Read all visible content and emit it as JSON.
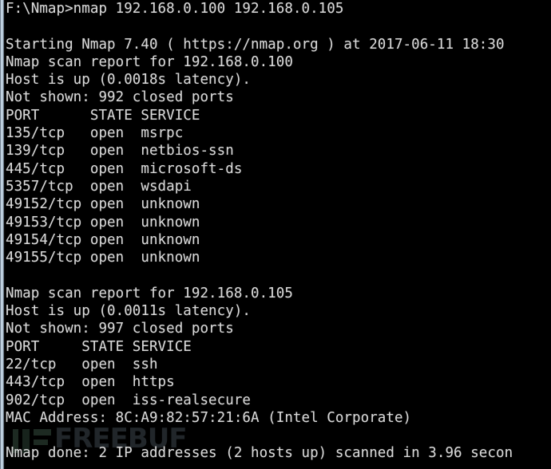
{
  "window": {
    "type": "windows-command-prompt",
    "background_color": "#000000",
    "text_color": "#d8d8d8",
    "border_color": "#b4c6d6"
  },
  "watermark": {
    "text": "FREEBUF",
    "color": "#21262a",
    "accent_color": "#1d2a22"
  },
  "terminal": {
    "prompt": "F:\\Nmap>",
    "command": "nmap 192.168.0.100 192.168.0.105",
    "lines": [
      "F:\\Nmap>nmap 192.168.0.100 192.168.0.105",
      "",
      "Starting Nmap 7.40 ( https://nmap.org ) at 2017-06-11 18:30 ",
      "Nmap scan report for 192.168.0.100",
      "Host is up (0.0018s latency).",
      "Not shown: 992 closed ports",
      "PORT      STATE SERVICE",
      "135/tcp   open  msrpc",
      "139/tcp   open  netbios-ssn",
      "445/tcp   open  microsoft-ds",
      "5357/tcp  open  wsdapi",
      "49152/tcp open  unknown",
      "49153/tcp open  unknown",
      "49154/tcp open  unknown",
      "49155/tcp open  unknown",
      "",
      "Nmap scan report for 192.168.0.105",
      "Host is up (0.0011s latency).",
      "Not shown: 997 closed ports",
      "PORT     STATE SERVICE",
      "22/tcp   open  ssh",
      "443/tcp  open  https",
      "902/tcp  open  iss-realsecure",
      "MAC Address: 8C:A9:82:57:21:6A (Intel Corporate)",
      "",
      "Nmap done: 2 IP addresses (2 hosts up) scanned in 3.96 secon"
    ]
  },
  "scan_summary": {
    "nmap_version": "7.40",
    "nmap_url": "https://nmap.org",
    "scan_datetime": "2017-06-11 18:30",
    "ip_addresses_scanned": "2",
    "hosts_up": "2",
    "duration_seconds": "3.96",
    "hosts": [
      {
        "ip": "192.168.0.100",
        "status": "Host is up",
        "latency": "0.0018s",
        "not_shown": "992 closed ports",
        "columns": [
          "PORT",
          "STATE",
          "SERVICE"
        ],
        "ports": [
          {
            "port": "135/tcp",
            "state": "open",
            "service": "msrpc"
          },
          {
            "port": "139/tcp",
            "state": "open",
            "service": "netbios-ssn"
          },
          {
            "port": "445/tcp",
            "state": "open",
            "service": "microsoft-ds"
          },
          {
            "port": "5357/tcp",
            "state": "open",
            "service": "wsdapi"
          },
          {
            "port": "49152/tcp",
            "state": "open",
            "service": "unknown"
          },
          {
            "port": "49153/tcp",
            "state": "open",
            "service": "unknown"
          },
          {
            "port": "49154/tcp",
            "state": "open",
            "service": "unknown"
          },
          {
            "port": "49155/tcp",
            "state": "open",
            "service": "unknown"
          }
        ],
        "mac_address": ""
      },
      {
        "ip": "192.168.0.105",
        "status": "Host is up",
        "latency": "0.0011s",
        "not_shown": "997 closed ports",
        "columns": [
          "PORT",
          "STATE",
          "SERVICE"
        ],
        "ports": [
          {
            "port": "22/tcp",
            "state": "open",
            "service": "ssh"
          },
          {
            "port": "443/tcp",
            "state": "open",
            "service": "https"
          },
          {
            "port": "902/tcp",
            "state": "open",
            "service": "iss-realsecure"
          }
        ],
        "mac_address": "8C:A9:82:57:21:6A",
        "mac_vendor": "Intel Corporate"
      }
    ]
  }
}
